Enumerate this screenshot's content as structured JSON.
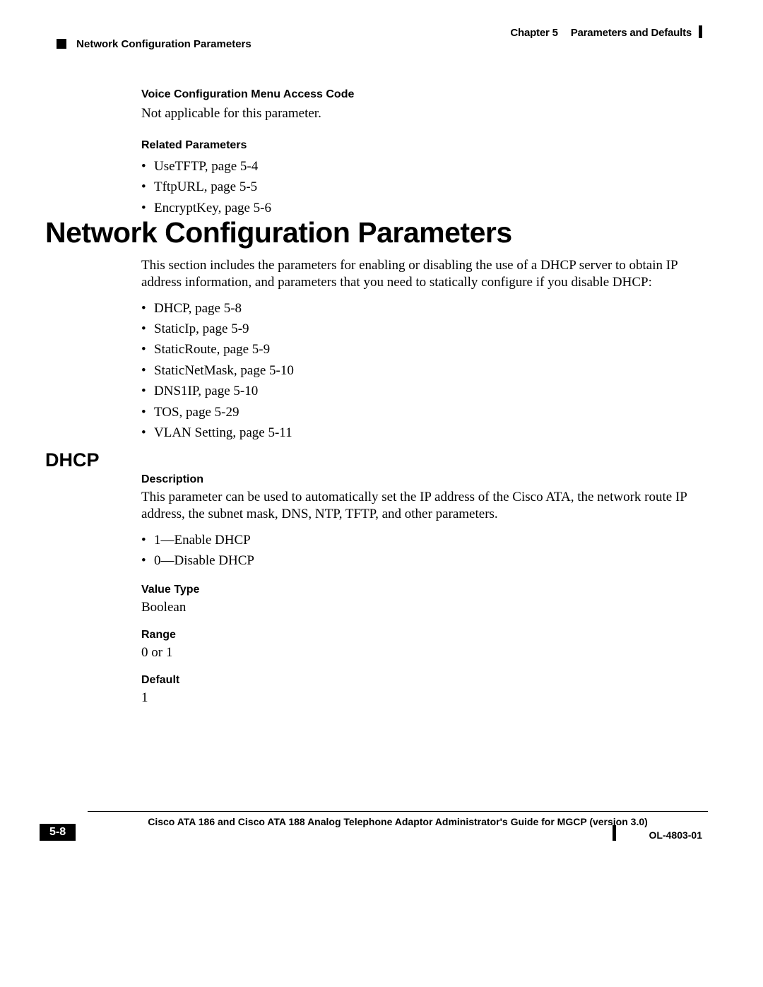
{
  "header": {
    "chapter_label": "Chapter 5",
    "chapter_title": "Parameters and Defaults",
    "section_running": "Network Configuration Parameters"
  },
  "voice_access": {
    "heading": "Voice Configuration Menu Access Code",
    "text": "Not applicable for this parameter."
  },
  "related": {
    "heading": "Related Parameters",
    "items": [
      "UseTFTP, page 5-4",
      "TftpURL, page 5-5",
      "EncryptKey, page 5-6"
    ]
  },
  "main_heading": "Network Configuration Parameters",
  "intro_text": "This section includes the parameters for enabling or disabling the use of a DHCP server to obtain IP address information, and parameters that you need to statically configure if you disable DHCP:",
  "intro_items": [
    "DHCP, page 5-8",
    "StaticIp, page 5-9",
    "StaticRoute, page 5-9",
    "StaticNetMask, page 5-10",
    "DNS1IP, page 5-10",
    "TOS, page 5-29",
    "VLAN Setting, page 5-11"
  ],
  "dhcp": {
    "heading": "DHCP",
    "desc_label": "Description",
    "desc_text": "This parameter can be used to automatically set the IP address of the Cisco ATA, the network route IP address, the subnet mask, DNS, NTP, TFTP, and other parameters.",
    "desc_items": [
      "1—Enable DHCP",
      "0—Disable DHCP"
    ],
    "value_type_label": "Value Type",
    "value_type": "Boolean",
    "range_label": "Range",
    "range": "0 or 1",
    "default_label": "Default",
    "default": "1"
  },
  "footer": {
    "title": "Cisco ATA 186 and Cisco ATA 188 Analog Telephone Adaptor Administrator's Guide for MGCP (version 3.0)",
    "page": "5-8",
    "code": "OL-4803-01"
  }
}
